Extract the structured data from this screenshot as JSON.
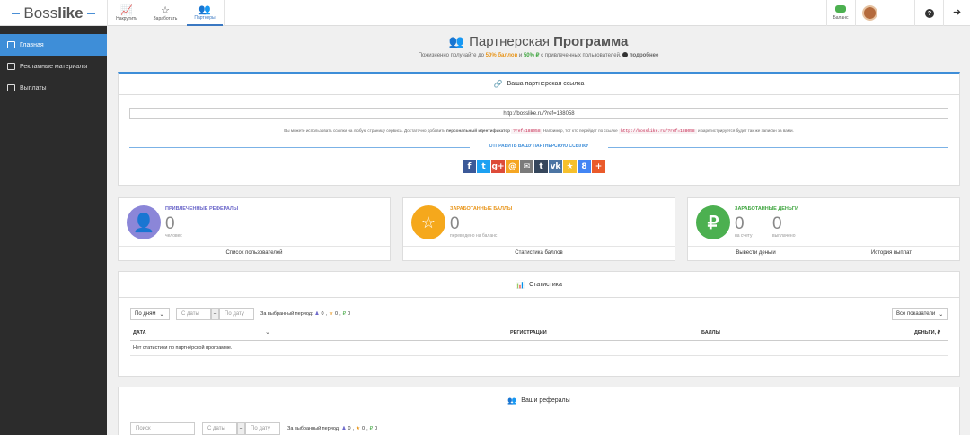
{
  "topbar": {
    "logo_a": "Boss",
    "logo_b": "like",
    "tabs": [
      {
        "label": "Накрутить",
        "icon": "chart-icon"
      },
      {
        "label": "Заработать",
        "icon": "star-icon"
      },
      {
        "label": "Партнеры",
        "icon": "users-icon"
      }
    ],
    "balance_label": "Баланс",
    "help_icon": "question-icon",
    "logout_icon": "logout-icon"
  },
  "sidebar": {
    "items": [
      {
        "label": "Главная",
        "icon": "dashboard-icon"
      },
      {
        "label": "Рекламные материалы",
        "icon": "image-icon"
      },
      {
        "label": "Выплаты",
        "icon": "money-icon"
      }
    ]
  },
  "header": {
    "title_light": "Партнерская ",
    "title_bold": "Программа",
    "subtitle_a": "Пожизненно получайте до ",
    "subtitle_pct1": "50% баллов",
    "subtitle_b": " и ",
    "subtitle_pct2": "50% ₽",
    "subtitle_c": " с привлеченных пользователей,",
    "subtitle_more": "подробнее"
  },
  "link_panel": {
    "title": "Ваша партнерская ссылка",
    "link_value": "http://bosslike.ru/?ref=188058",
    "hint_a": "Вы можете использовать ссылки на любую страницу сервиса. Достаточно добавить ",
    "hint_bold": "персональный идентификатор",
    "hint_code1": "?ref=188058",
    "hint_b": " Например, тот кто перейдет по ссылке ",
    "hint_code2": "http://bosslike.ru/?ref=188058",
    "hint_c": " и зарегистрируется будет так же записан за вами.",
    "share_label": "ОТПРАВИТЬ ВАШУ ПАРТНЕРСКУЮ ССЫЛКУ",
    "socials": [
      {
        "name": "facebook-icon",
        "glyph": "f",
        "color": "#3b5998"
      },
      {
        "name": "twitter-icon",
        "glyph": "t",
        "color": "#1da1f2"
      },
      {
        "name": "googleplus-icon",
        "glyph": "g+",
        "color": "#dd4b39"
      },
      {
        "name": "mail-ru-icon",
        "glyph": "@",
        "color": "#f5a623"
      },
      {
        "name": "email-icon",
        "glyph": "✉",
        "color": "#7a7a7a"
      },
      {
        "name": "tumblr-icon",
        "glyph": "t",
        "color": "#35465c"
      },
      {
        "name": "vk-icon",
        "glyph": "vk",
        "color": "#4c75a3"
      },
      {
        "name": "favorite-icon",
        "glyph": "★",
        "color": "#f6c02c"
      },
      {
        "name": "google-icon",
        "glyph": "8",
        "color": "#4285f4"
      },
      {
        "name": "add-icon",
        "glyph": "+",
        "color": "#ea5a2b"
      }
    ]
  },
  "cards": [
    {
      "title": "ПРИВЛЕЧЕННЫЕ РЕФЕРАЛЫ",
      "title_color": "#6a66c9",
      "icon": "user-icon",
      "circle_color": "#8b86d8",
      "values": [
        {
          "num": "0",
          "sub": "человек"
        }
      ],
      "links": [
        "Список пользователей"
      ]
    },
    {
      "title": "ЗАРАБОТАННЫЕ БАЛЛЫ",
      "title_color": "#e8951a",
      "icon": "star-icon",
      "circle_color": "#f5a81c",
      "values": [
        {
          "num": "0",
          "sub": "переведено на баланс"
        }
      ],
      "links": [
        "Статистика баллов"
      ]
    },
    {
      "title": "ЗАРАБОТАННЫЕ ДЕНЬГИ",
      "title_color": "#3fa53f",
      "icon": "ruble-icon",
      "circle_color": "#4cb050",
      "values": [
        {
          "num": "0",
          "sub": "на счету"
        },
        {
          "num": "0",
          "sub": "выплачено"
        }
      ],
      "links": [
        "Вывести деньги",
        "История выплат"
      ]
    }
  ],
  "stats": {
    "title": "Статистика",
    "period_select": "По дням",
    "date_from": "С даты",
    "dash": "–",
    "date_to": "По дату",
    "period_label": "За выбранный период:",
    "period_vals": [
      "0",
      "0",
      "0"
    ],
    "indicators_select": "Все показатели",
    "columns": [
      "ДАТА",
      "РЕГИСТРАЦИИ",
      "БАЛЛЫ",
      "ДЕНЬГИ, ₽"
    ],
    "empty_text": "Нет статистики по партнёрской программе."
  },
  "referrals": {
    "title": "Ваши рефералы",
    "search_placeholder": "Поиск",
    "date_from": "С даты",
    "dash": "–",
    "date_to": "По дату",
    "period_label": "За выбранный период:",
    "period_vals": [
      "0",
      "0",
      "0"
    ]
  }
}
